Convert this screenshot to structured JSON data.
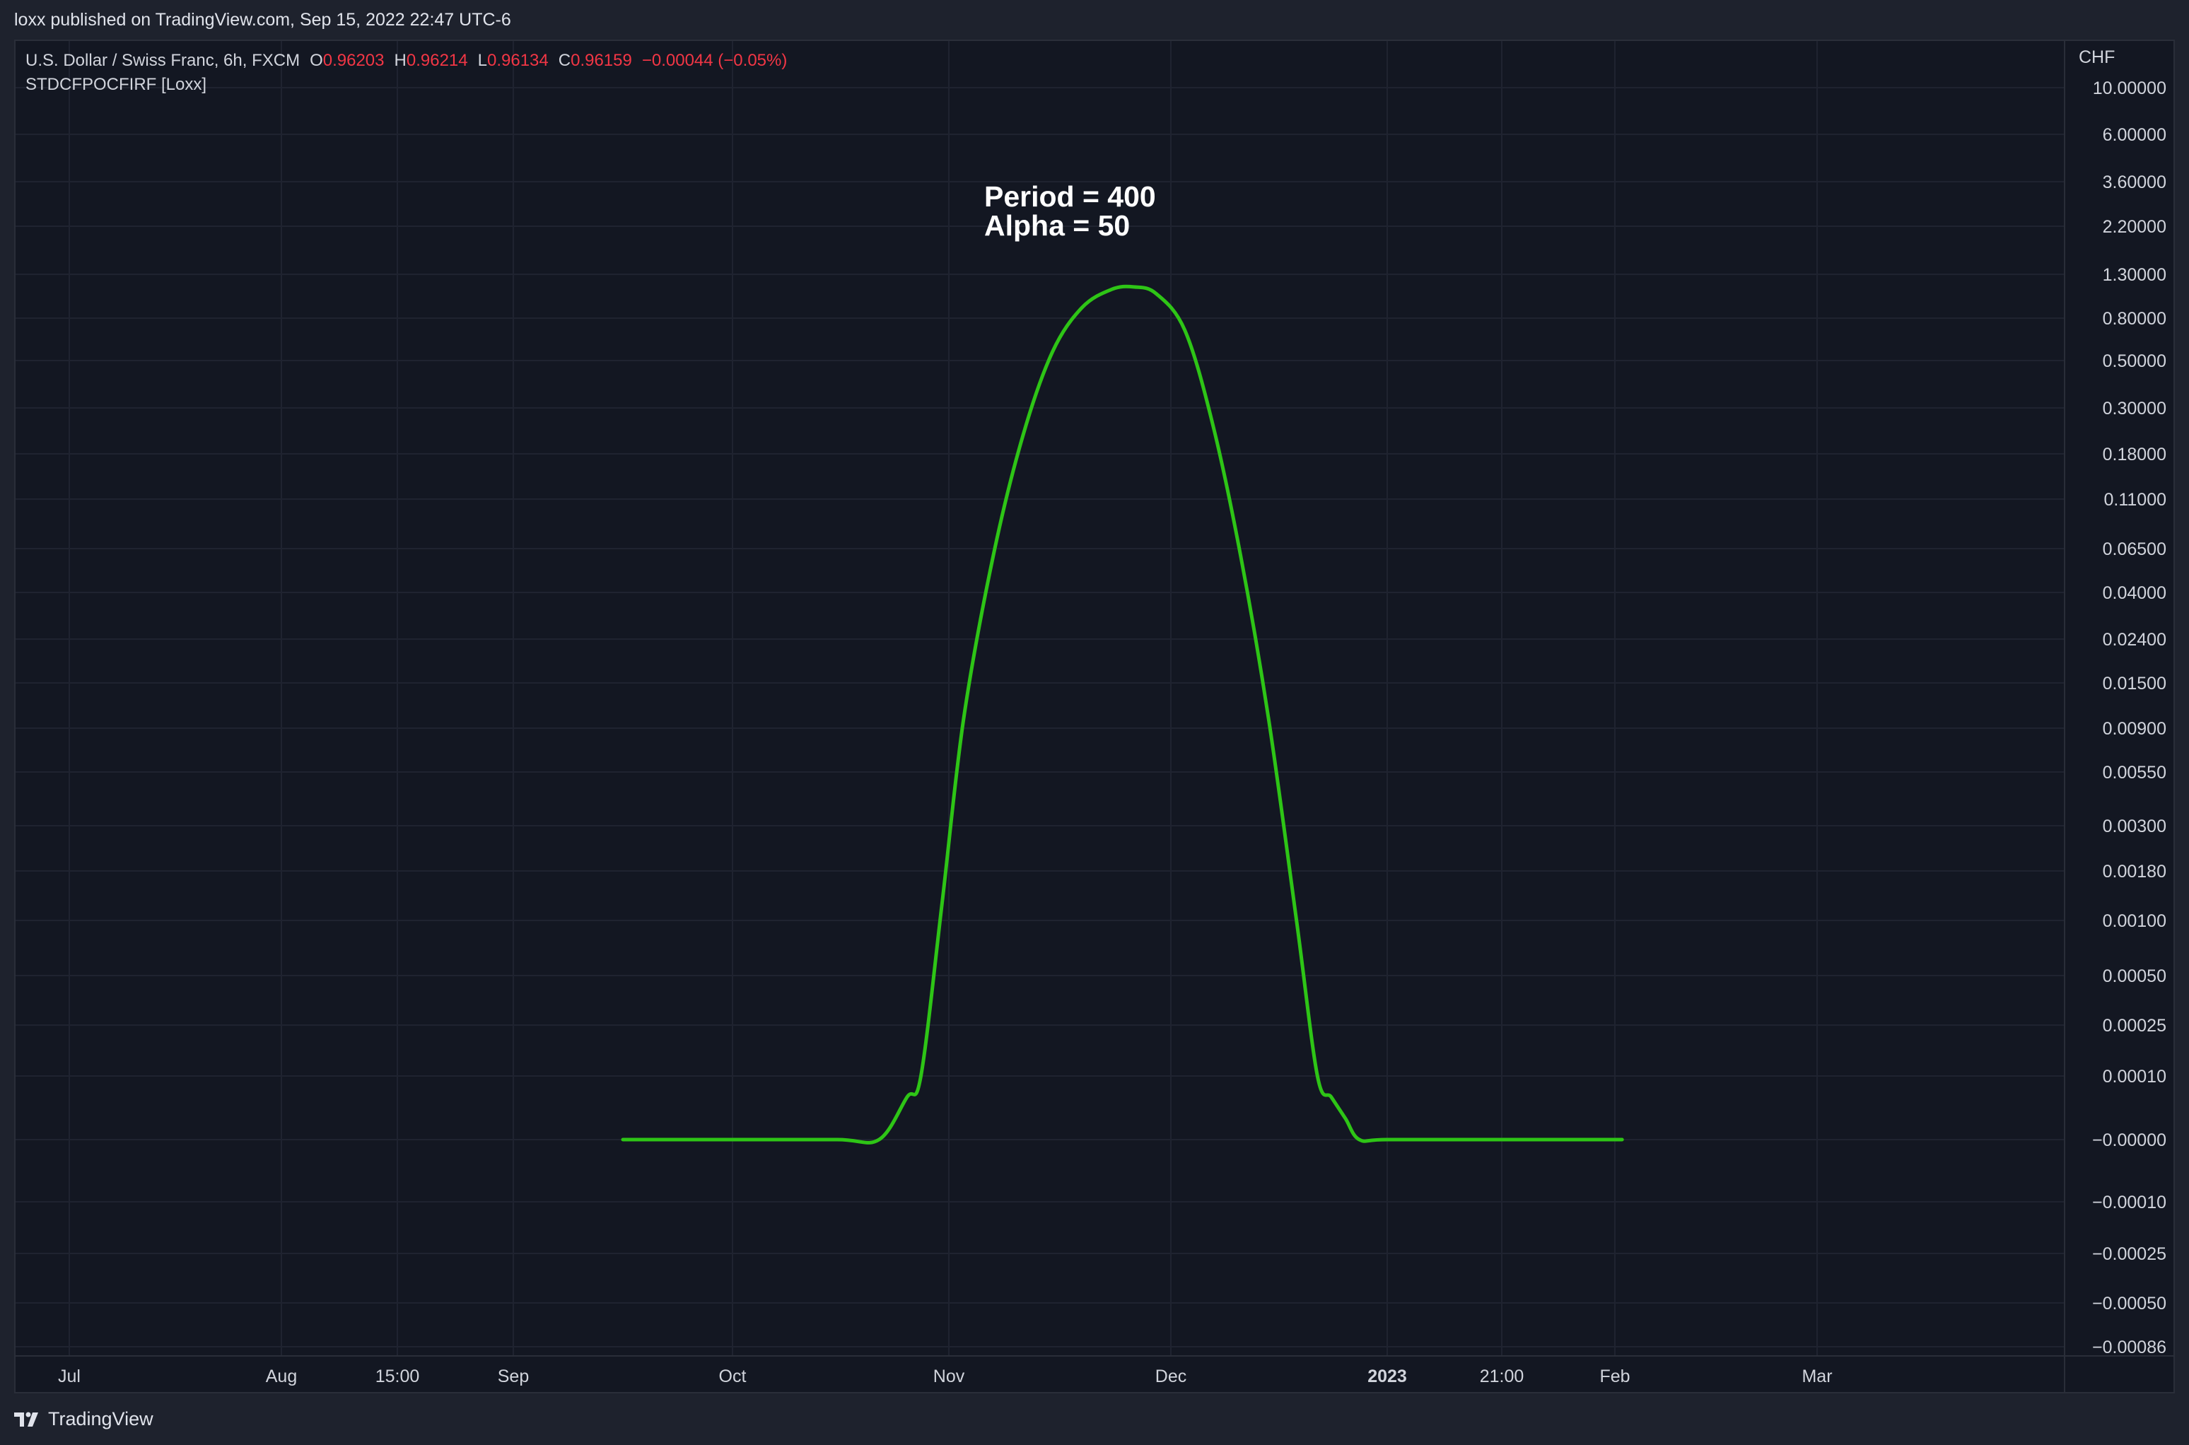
{
  "header": {
    "published": "loxx published on TradingView.com, Sep 15, 2022 22:47 UTC-6"
  },
  "legend": {
    "symbol": "U.S. Dollar / Swiss Franc, 6h, FXCM",
    "open_label": "O",
    "open": "0.96203",
    "high_label": "H",
    "high": "0.96214",
    "low_label": "L",
    "low": "0.96134",
    "close_label": "C",
    "close": "0.96159",
    "change": "−0.00044 (−0.05%)",
    "indicator": "STDCFPOCFIRF [Loxx]"
  },
  "annotation": {
    "line1": "Period = 400",
    "line2": "Alpha = 50"
  },
  "footer": {
    "brand": "TradingView"
  },
  "colors": {
    "background": "#131722",
    "grid": "#1f2330",
    "line": "#2ec516",
    "text": "#d1d4dc",
    "negative": "#f23645"
  },
  "chart_data": {
    "type": "line",
    "currency_label": "CHF",
    "y_scale": "log",
    "y_ticks": [
      "10.00000",
      "6.00000",
      "3.60000",
      "2.20000",
      "1.30000",
      "0.80000",
      "0.50000",
      "0.30000",
      "0.18000",
      "0.11000",
      "0.06500",
      "0.04000",
      "0.02400",
      "0.01500",
      "0.00900",
      "0.00550",
      "0.00300",
      "0.00180",
      "0.00100",
      "0.00050",
      "0.00025",
      "0.00010",
      "−0.00000",
      "−0.00010",
      "−0.00025",
      "−0.00050",
      "−0.00086"
    ],
    "x_ticks": [
      {
        "label": "Jul",
        "bold": false
      },
      {
        "label": "Aug",
        "bold": false
      },
      {
        "label": "15:00",
        "bold": false
      },
      {
        "label": "Sep",
        "bold": false
      },
      {
        "label": "Oct",
        "bold": false
      },
      {
        "label": "Nov",
        "bold": false
      },
      {
        "label": "Dec",
        "bold": false
      },
      {
        "label": "2023",
        "bold": true
      },
      {
        "label": "21:00",
        "bold": false
      },
      {
        "label": "Feb",
        "bold": false
      },
      {
        "label": "Mar",
        "bold": false
      }
    ],
    "x_tick_dates": [
      "2022-07-01",
      "2022-08-01",
      "2022-08-16",
      "2022-09-01",
      "2022-10-01",
      "2022-11-01",
      "2022-12-01",
      "2023-01-01",
      "2023-01-16",
      "2023-02-01",
      "2023-03-01"
    ],
    "series": [
      {
        "x": [
          "2022-09-16",
          "2022-10-01",
          "2022-10-16",
          "2022-10-22",
          "2022-10-26",
          "2022-10-28",
          "2022-10-31",
          "2022-11-03",
          "2022-11-07",
          "2022-11-11",
          "2022-11-15",
          "2022-11-19",
          "2022-11-23",
          "2022-11-26",
          "2022-11-29",
          "2022-12-03",
          "2022-12-07",
          "2022-12-11",
          "2022-12-15",
          "2022-12-19",
          "2022-12-22",
          "2022-12-24",
          "2022-12-26",
          "2022-12-28",
          "2023-01-01",
          "2023-01-16",
          "2023-02-02"
        ],
        "y": [
          0,
          0,
          0,
          0,
          1e-05,
          0.0001,
          0.0012,
          0.01,
          0.06,
          0.22,
          0.55,
          0.9,
          1.1,
          1.13,
          1.05,
          0.7,
          0.25,
          0.06,
          0.01,
          0.001,
          0.0001,
          1e-05,
          1e-06,
          0,
          0,
          0,
          0
        ]
      }
    ]
  }
}
